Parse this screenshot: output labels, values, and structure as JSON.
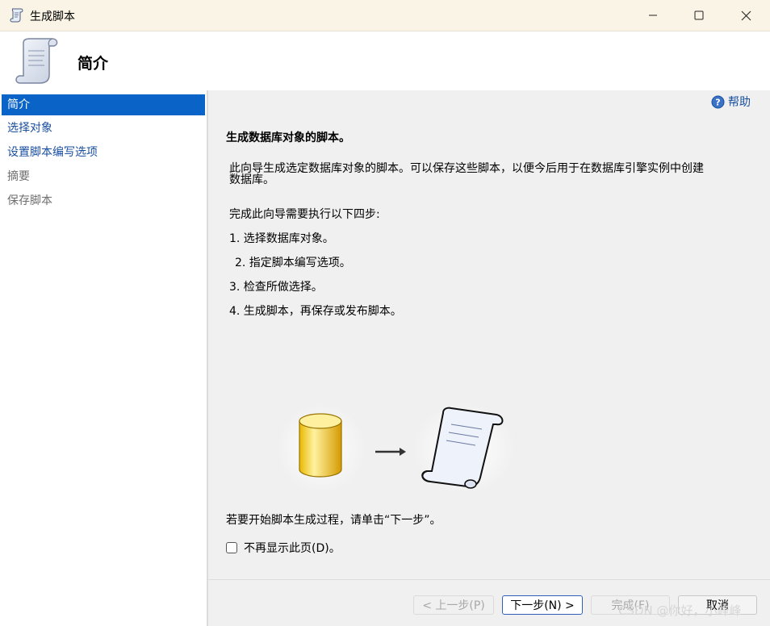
{
  "window": {
    "title": "生成脚本",
    "icon": "scroll-icon",
    "controls": [
      "minimize-icon",
      "maximize-icon",
      "close-icon"
    ]
  },
  "header": {
    "title": "简介",
    "icon": "scroll-icon"
  },
  "sidebar": {
    "items": [
      {
        "label": "简介",
        "state": "active"
      },
      {
        "label": "选择对象",
        "state": "link"
      },
      {
        "label": "设置脚本编写选项",
        "state": "link"
      },
      {
        "label": "摘要",
        "state": "disabled"
      },
      {
        "label": "保存脚本",
        "state": "disabled"
      }
    ]
  },
  "main": {
    "help_label": "帮助",
    "section_title": "生成数据库对象的脚本。",
    "description_line1": "此向导生成选定数据库对象的脚本。可以保存这些脚本，以便今后用于在数据库引擎实例中创建",
    "description_line2": "数据库。",
    "steps_intro": "完成此向导需要执行以下四步:",
    "steps": [
      "1. 选择数据库对象。",
      "2. 指定脚本编写选项。",
      "3. 检查所做选择。",
      "4. 生成脚本，再保存或发布脚本。"
    ],
    "start_hint": "若要开始脚本生成过程，请单击“下一步”。",
    "checkbox_label": "不再显示此页(D)。",
    "checkbox_checked": false
  },
  "buttons": {
    "prev": "< 上一步(P)",
    "next": "下一步(N) >",
    "finish": "完成(F)",
    "cancel": "取消"
  },
  "watermark": "CSDN @你好，小峰峰",
  "colors": {
    "accent": "#0a64c8",
    "link": "#1a4fa0",
    "titlebar": "#faf4e6"
  }
}
